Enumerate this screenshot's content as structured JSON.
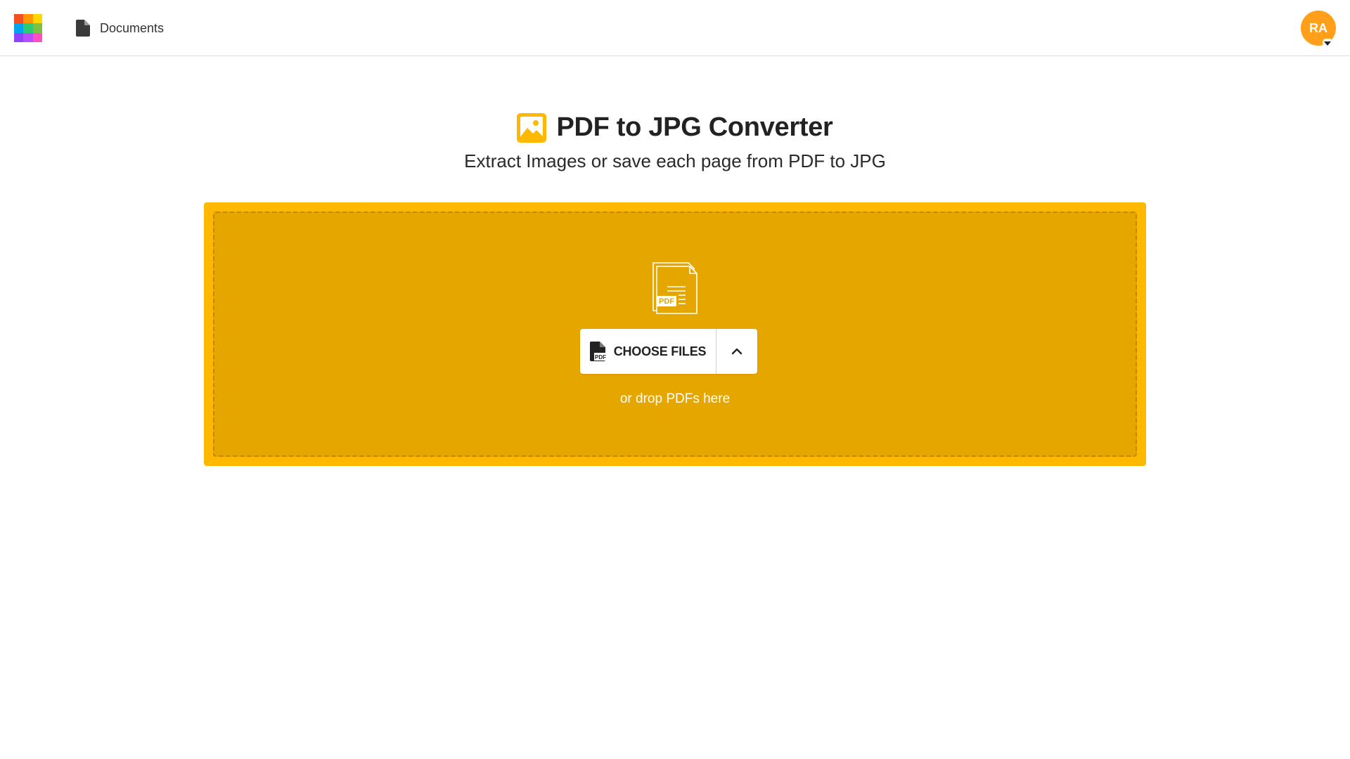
{
  "header": {
    "logo_colors": [
      "#f25022",
      "#ff9800",
      "#ffd600",
      "#00a4ef",
      "#2ecc71",
      "#7cc242",
      "#8e44ff",
      "#b84dff",
      "#ff4fc3"
    ],
    "nav_documents_label": "Documents",
    "nav_documents_icon": "document-icon",
    "avatar_initials": "RA",
    "avatar_color": "#ff9f1a"
  },
  "main": {
    "title": "PDF to JPG Converter",
    "title_icon": "image-icon",
    "subtitle": "Extract Images or save each page from PDF to JPG",
    "accent_color": "#ffb800",
    "dropzone": {
      "icon": "pdf-files-icon",
      "icon_text": "PDF",
      "choose_button_label": "CHOOSE FILES",
      "choose_button_icon": "pdf-file-icon",
      "choose_button_icon_text": "PDF",
      "expand_icon": "chevron-up-icon",
      "hint": "or drop PDFs here"
    }
  }
}
